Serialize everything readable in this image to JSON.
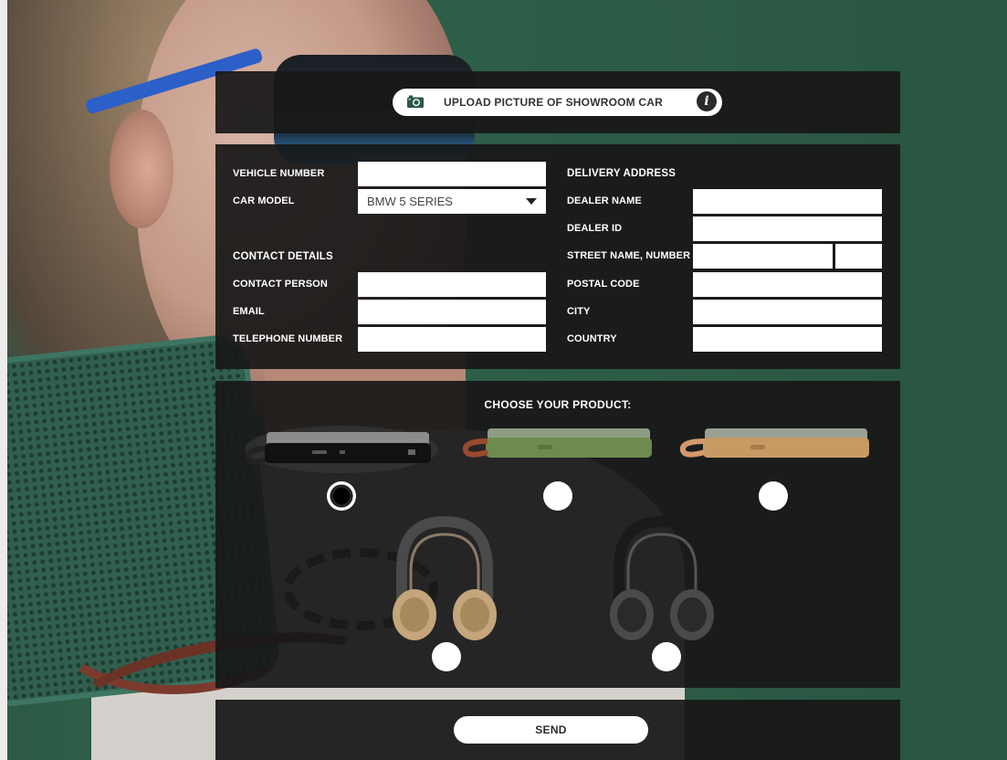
{
  "upload": {
    "label": "UPLOAD PICTURE OF SHOWROOM CAR",
    "camera_icon": "camera-icon",
    "info_icon": "info-icon",
    "info_glyph": "i"
  },
  "form": {
    "vehicle_number_label": "VEHICLE NUMBER",
    "vehicle_number_value": "",
    "car_model_label": "CAR MODEL",
    "car_model_value": "BMW 5 SERIES",
    "contact_details_title": "CONTACT DETAILS",
    "contact_person_label": "CONTACT PERSON",
    "contact_person_value": "",
    "email_label": "EMAIL",
    "email_value": "",
    "telephone_label": "TELEPHONE NUMBER",
    "telephone_value": "",
    "delivery_address_title": "DELIVERY ADDRESS",
    "dealer_name_label": "DEALER NAME",
    "dealer_name_value": "",
    "dealer_id_label": "DEALER ID",
    "dealer_id_value": "",
    "street_label": "STREET NAME, NUMBER",
    "street_value": "",
    "street_number_value": "",
    "postal_code_label": "POSTAL CODE",
    "postal_code_value": "",
    "city_label": "CITY",
    "city_value": "",
    "country_label": "COUNTRY",
    "country_value": ""
  },
  "products": {
    "title": "CHOOSE YOUR PRODUCT:",
    "items": [
      {
        "name": "speaker-black",
        "color": "#1c1c1c",
        "selected": true
      },
      {
        "name": "speaker-green",
        "color": "#6d8a4f",
        "selected": false
      },
      {
        "name": "speaker-natural",
        "color": "#b48454",
        "selected": false
      },
      {
        "name": "headphones-natural",
        "color": "#c4a57c",
        "selected": false
      },
      {
        "name": "headphones-black",
        "color": "#3a3a3a",
        "selected": false
      }
    ]
  },
  "send": {
    "label": "SEND"
  },
  "colors": {
    "panel": "#181818",
    "background_green": "#2f6149",
    "button": "#ffffff"
  }
}
